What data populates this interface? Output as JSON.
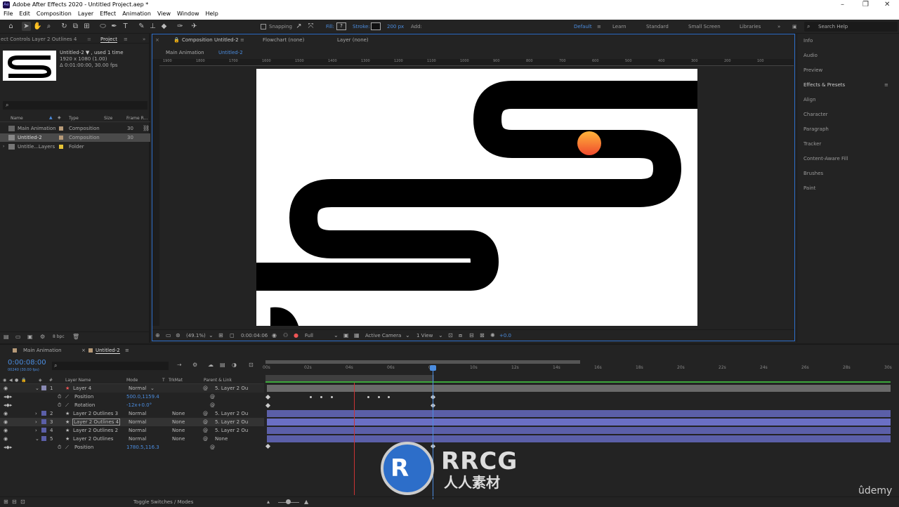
{
  "titlebar": {
    "title": "Adobe After Effects 2020 - Untitled Project.aep *"
  },
  "menu": [
    "File",
    "Edit",
    "Composition",
    "Layer",
    "Effect",
    "Animation",
    "View",
    "Window",
    "Help"
  ],
  "toolbar": {
    "snapping": "Snapping",
    "fill": "Fill:",
    "fill_val": "?",
    "stroke": "Stroke:",
    "stroke_px": "200 px",
    "add": "Add:"
  },
  "workspaces": [
    "Default",
    "Learn",
    "Standard",
    "Small Screen",
    "Libraries"
  ],
  "search": "Search Help",
  "left": {
    "tab_effect": "ect Controls Layer 2 Outlines 4",
    "tab_project": "Project",
    "info_name": "Untitled-2 ▼ , used 1 time",
    "info_res": "1920 x 1080 (1.00)",
    "info_dur": "Δ 0:01:00:00, 30.00 fps",
    "cols": {
      "name": "Name",
      "type": "Type",
      "size": "Size",
      "fr": "Frame R..."
    },
    "items": [
      {
        "name": "Main Animation",
        "type": "Composition",
        "fr": "30"
      },
      {
        "name": "Untitled-2",
        "type": "Composition",
        "fr": "30"
      },
      {
        "name": "Untitle...Layers",
        "type": "Folder",
        "fr": ""
      }
    ],
    "bpc": "8 bpc"
  },
  "comp": {
    "tab": "Composition Untitled-2",
    "flowchart": "Flowchart (none)",
    "layer": "Layer (none)",
    "sub1": "Main Animation",
    "sub2": "Untitled-2",
    "ruler": [
      "1900",
      "1800",
      "1700",
      "1600",
      "1500",
      "1400",
      "1300",
      "1200",
      "1100",
      "1000",
      "900",
      "800",
      "700",
      "600",
      "500",
      "400",
      "300",
      "200",
      "100"
    ],
    "zoom": "(49.1%)",
    "time": "0:00:04:06",
    "res": "Full",
    "camera": "Active Camera",
    "view": "1 View",
    "exposure": "+0.0"
  },
  "right": [
    "Info",
    "Audio",
    "Preview",
    "Effects & Presets",
    "Align",
    "Character",
    "Paragraph",
    "Tracker",
    "Content-Aware Fill",
    "Brushes",
    "Paint"
  ],
  "timeline": {
    "tab1": "Main Animation",
    "tab2": "Untitled-2",
    "timecode": "0:00:08:00",
    "fps": "00240 (30.00 fps)",
    "cols": {
      "name": "Layer Name",
      "mode": "Mode",
      "t": "T",
      "trk": "TrkMat",
      "parent": "Parent & Link"
    },
    "ticks": [
      "00s",
      "02s",
      "04s",
      "06s",
      "08s",
      "10s",
      "12s",
      "14s",
      "16s",
      "18s",
      "20s",
      "22s",
      "24s",
      "26s",
      "28s",
      "30s"
    ],
    "rows": [
      {
        "num": "1",
        "name": "Layer 4",
        "mode": "Normal",
        "trk": "",
        "parent": "5. Layer 2 Ou"
      },
      {
        "num": "",
        "name": "Position",
        "val": "500.0,1159.4"
      },
      {
        "num": "",
        "name": "Rotation",
        "val": "-12x+0.0°"
      },
      {
        "num": "2",
        "name": "Layer 2 Outlines 3",
        "mode": "Normal",
        "trk": "None",
        "parent": "5. Layer 2 Ou"
      },
      {
        "num": "3",
        "name": "Layer 2 Outlines 4",
        "mode": "Normal",
        "trk": "None",
        "parent": "5. Layer 2 Ou"
      },
      {
        "num": "4",
        "name": "Layer 2 Outlines 2",
        "mode": "Normal",
        "trk": "None",
        "parent": "5. Layer 2 Ou"
      },
      {
        "num": "5",
        "name": "Layer 2 Outlines",
        "mode": "Normal",
        "trk": "None",
        "parent": "None"
      },
      {
        "num": "",
        "name": "Position",
        "val": "1780.5,116.3"
      }
    ],
    "toggle": "Toggle Switches / Modes"
  },
  "watermark": {
    "brand": "RRCG",
    "sub": "人人素材",
    "udemy": "ûdemy"
  },
  "colors": {
    "accent": "#2d6ec9",
    "layer_bar": "#5b5fa8"
  }
}
